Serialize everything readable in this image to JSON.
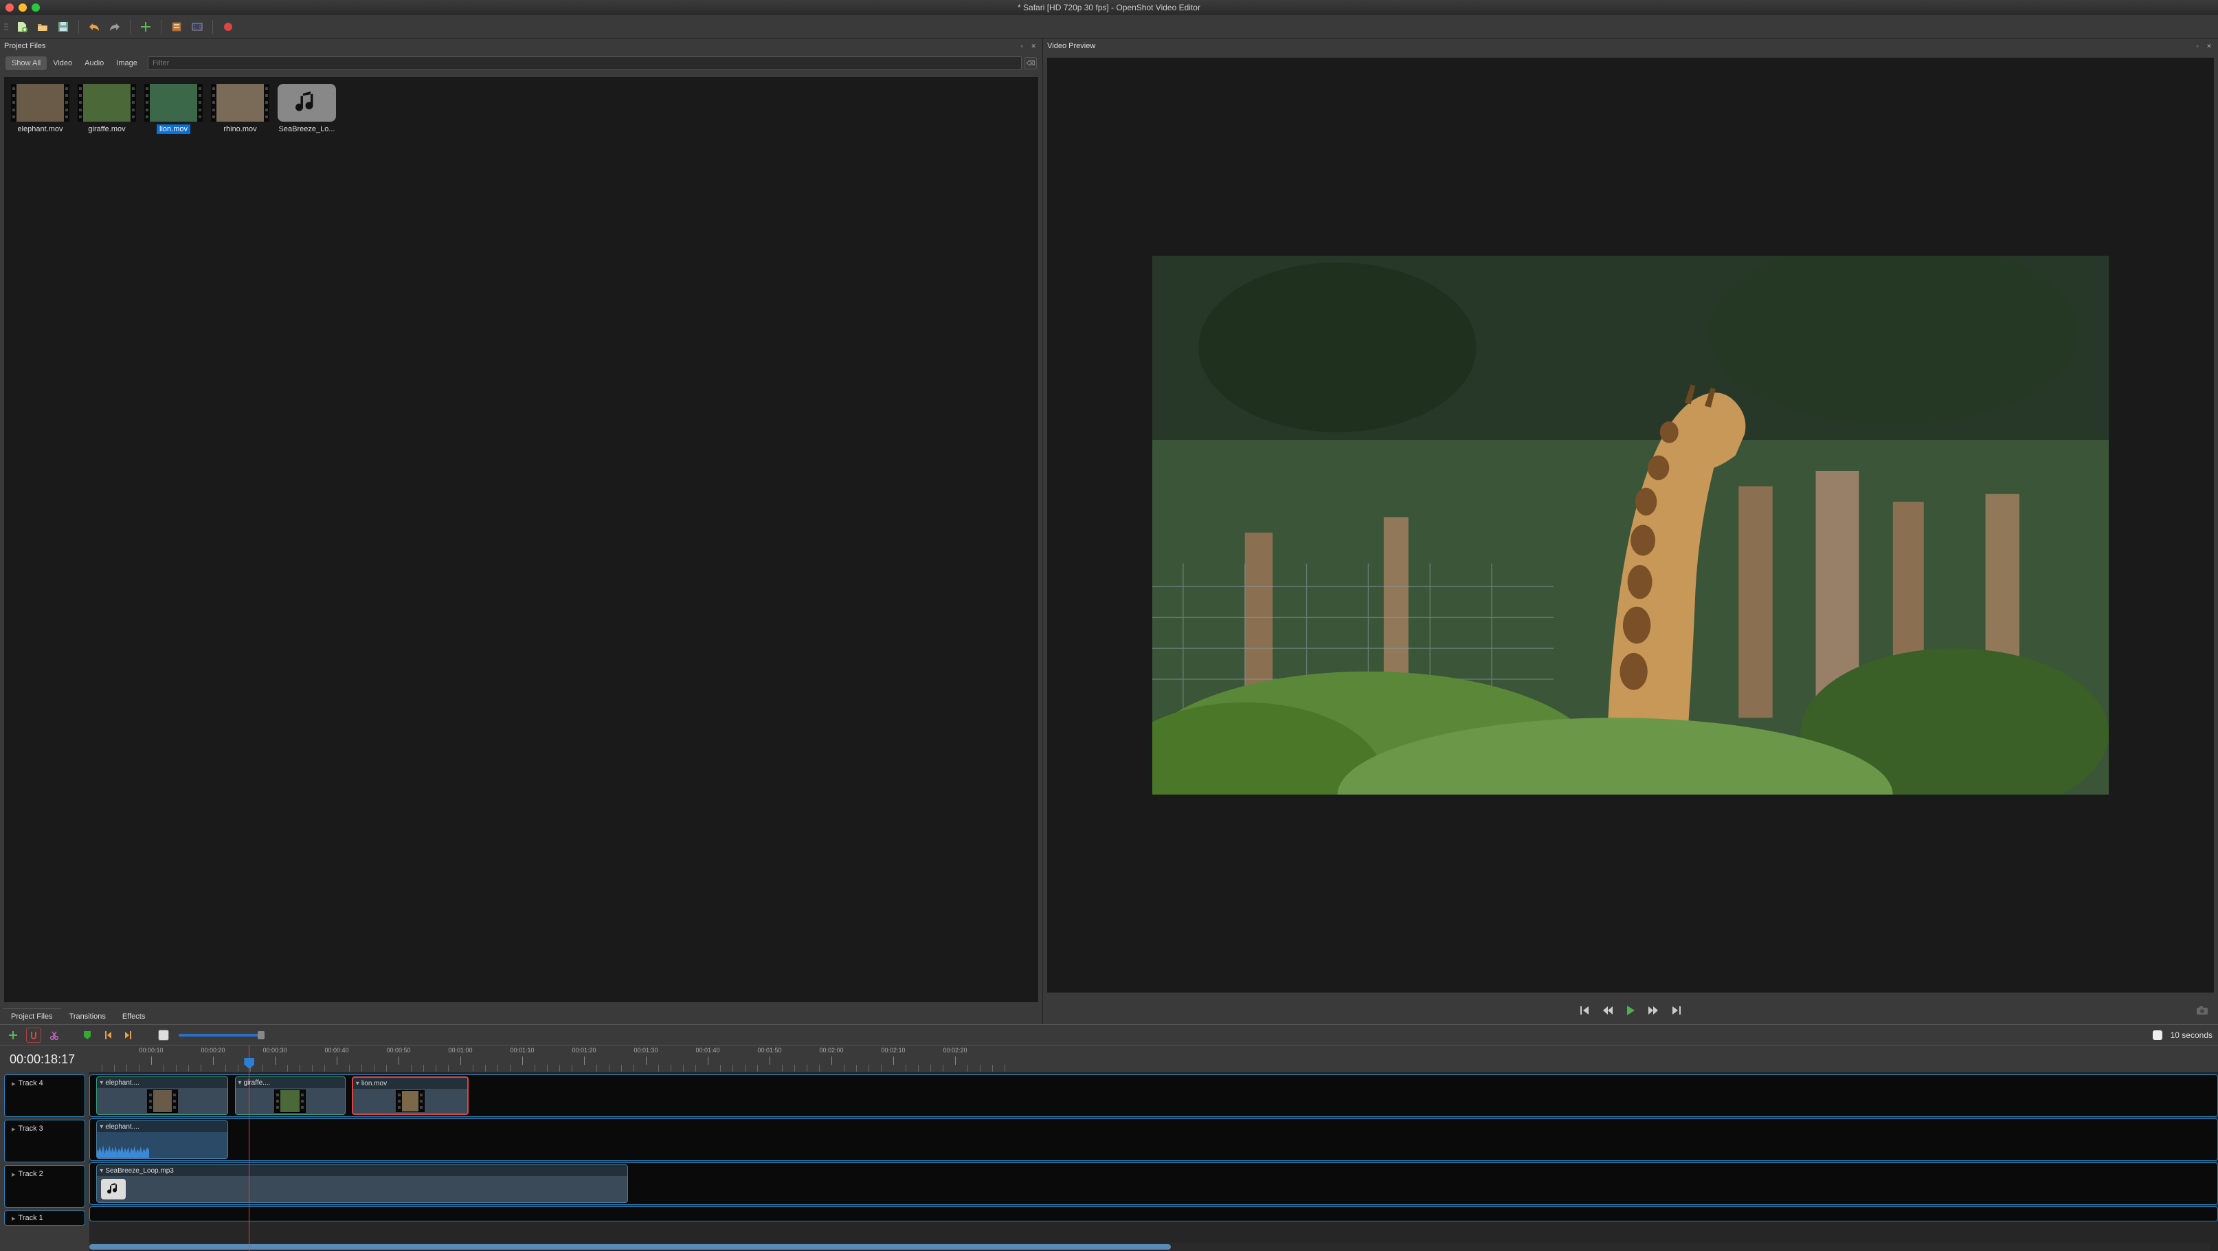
{
  "window": {
    "title": "* Safari [HD 720p 30 fps] - OpenShot Video Editor"
  },
  "panes": {
    "project_files": "Project Files",
    "video_preview": "Video Preview"
  },
  "filters": {
    "show_all": "Show All",
    "video": "Video",
    "audio": "Audio",
    "image": "Image",
    "placeholder": "Filter"
  },
  "files": [
    {
      "name": "elephant.mov",
      "type": "video"
    },
    {
      "name": "giraffe.mov",
      "type": "video"
    },
    {
      "name": "lion.mov",
      "type": "video",
      "selected": true
    },
    {
      "name": "rhino.mov",
      "type": "video"
    },
    {
      "name": "SeaBreeze_Lo...",
      "type": "audio"
    }
  ],
  "left_tabs": {
    "project_files": "Project Files",
    "transitions": "Transitions",
    "effects": "Effects"
  },
  "zoom_label": "10 seconds",
  "time_display": "00:00:18:17",
  "ruler_ticks": [
    "00:00:10",
    "00:00:20",
    "00:00:30",
    "00:00:40",
    "00:00:50",
    "00:01:00",
    "00:01:10",
    "00:01:20",
    "00:01:30",
    "00:01:40",
    "00:01:50",
    "00:02:00",
    "00:02:10",
    "00:02:20"
  ],
  "tracks": [
    {
      "name": "Track 4"
    },
    {
      "name": "Track 3"
    },
    {
      "name": "Track 2"
    },
    {
      "name": "Track 1"
    }
  ],
  "clips": {
    "t4_a": "elephant....",
    "t4_b": "giraffe....",
    "t4_c": "lion.mov",
    "t3_a": "elephant....",
    "t2_a": "SeaBreeze_Loop.mp3"
  },
  "playhead_pct": 7.5,
  "scroll": {
    "left_pct": 0,
    "width_pct": 51
  }
}
